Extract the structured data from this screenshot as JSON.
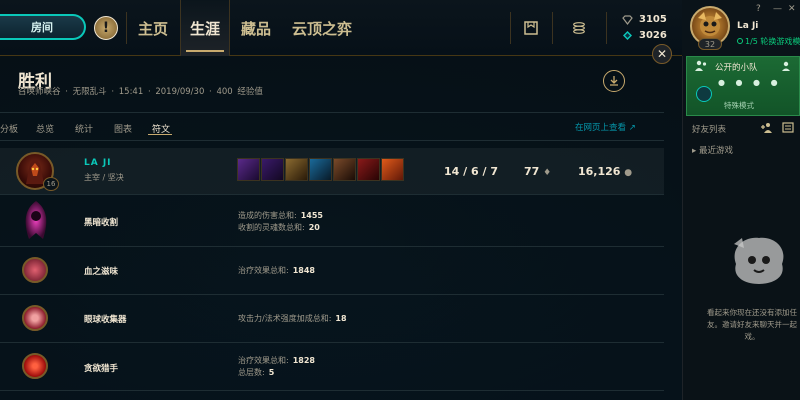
{
  "topnav": {
    "room_label": "房间",
    "alert_icon": "!",
    "tabs": [
      {
        "label": "主页",
        "active": false
      },
      {
        "label": "生涯",
        "active": true
      },
      {
        "label": "藏品",
        "active": false
      },
      {
        "label": "云顶之弈",
        "active": false
      }
    ],
    "blue_essence": "3105",
    "riot_points": "3026"
  },
  "profile": {
    "name": "La Ji",
    "level": "32",
    "status": "1/5 轮换游戏模"
  },
  "window_controls": {
    "help": "?",
    "minimize": "—",
    "close": "✕"
  },
  "match": {
    "result": "胜利",
    "map": "召唤师峡谷",
    "mode": "无限乱斗",
    "duration": "15:41",
    "date": "2019/09/30",
    "xp": "400 经验值",
    "subtabs": [
      {
        "label": "分板",
        "active": false
      },
      {
        "label": "总览",
        "active": false
      },
      {
        "label": "统计",
        "active": false
      },
      {
        "label": "图表",
        "active": false
      },
      {
        "label": "符文",
        "active": true
      }
    ],
    "web_link": "在网页上查看 ↗"
  },
  "player": {
    "name": "LA JI",
    "sub": "主宰 / 坚决",
    "champ_level": "16",
    "kda": "14 / 6 / 7",
    "cs": "77",
    "gold": "16,126",
    "rune_colors": [
      "#5a2a8a",
      "#3a1a6a",
      "#8a6a30",
      "#1a4a6a",
      "#7a4a2a",
      "#8a1a1a",
      "#c04a1a"
    ]
  },
  "runes": [
    {
      "name": "黑暗收割",
      "lines": [
        {
          "label": "造成的伤害总和:",
          "value": "1455"
        },
        {
          "label": "收割的灵魂数总和:",
          "value": "20"
        }
      ],
      "color": "#b0208a"
    },
    {
      "name": "血之滋味",
      "lines": [
        {
          "label": "治疗效果总和:",
          "value": "1848"
        }
      ],
      "color": "#a02a3a"
    },
    {
      "name": "眼球收集器",
      "lines": [
        {
          "label": "攻击力/法术强度加成总和:",
          "value": "18"
        }
      ],
      "color": "#a02a3a"
    },
    {
      "name": "贪欲猎手",
      "lines": [
        {
          "label": "治疗效果总和:",
          "value": "1828"
        },
        {
          "label": "总层数:",
          "value": "5"
        }
      ],
      "color": "#c01a1a"
    }
  ],
  "sidebar": {
    "party_title": "公开的小队",
    "party_mode": "特殊模式",
    "friends_title": "好友列表",
    "add_friend": "+",
    "friend_group": "最近游戏",
    "empty_line1": "看起来你现在还没有添加任",
    "empty_line2": "友。邀请好友来聊天并一起",
    "empty_line3": "戏。"
  }
}
